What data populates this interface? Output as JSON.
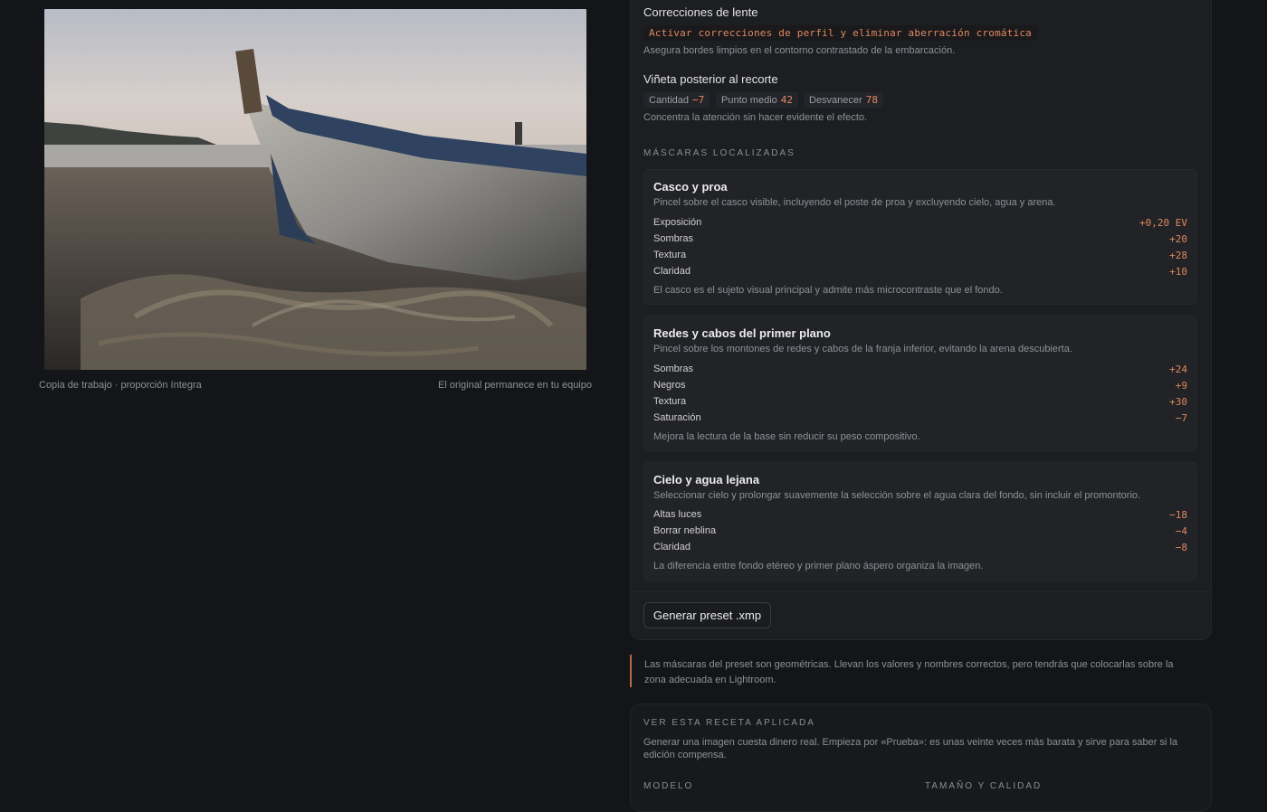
{
  "left": {
    "caption_left": "Copia de trabajo · proporción íntegra",
    "caption_right": "El original permanece en tu equipo"
  },
  "lens": {
    "title": "Correcciones de lente",
    "code": "Activar correcciones de perfil y eliminar aberración cromática",
    "desc": "Asegura bordes limpios en el contorno contrastado de la embarcación."
  },
  "vignette": {
    "title": "Viñeta posterior al recorte",
    "chips": [
      {
        "label": "Cantidad",
        "value": "−7"
      },
      {
        "label": "Punto medio",
        "value": "42"
      },
      {
        "label": "Desvanecer",
        "value": "78"
      }
    ],
    "desc": "Concentra la atención sin hacer evidente el efecto."
  },
  "masks": {
    "eyebrow": "MÁSCARAS LOCALIZADAS",
    "items": [
      {
        "title": "Casco y proa",
        "desc": "Pincel sobre el casco visible, incluyendo el poste de proa y excluyendo cielo, agua y arena.",
        "rows": [
          {
            "label": "Exposición",
            "value": "+0,20 EV"
          },
          {
            "label": "Sombras",
            "value": "+20"
          },
          {
            "label": "Textura",
            "value": "+28"
          },
          {
            "label": "Claridad",
            "value": "+10"
          }
        ],
        "foot": "El casco es el sujeto visual principal y admite más microcontraste que el fondo."
      },
      {
        "title": "Redes y cabos del primer plano",
        "desc": "Pincel sobre los montones de redes y cabos de la franja inferior, evitando la arena descubierta.",
        "rows": [
          {
            "label": "Sombras",
            "value": "+24"
          },
          {
            "label": "Negros",
            "value": "+9"
          },
          {
            "label": "Textura",
            "value": "+30"
          },
          {
            "label": "Saturación",
            "value": "−7"
          }
        ],
        "foot": "Mejora la lectura de la base sin reducir su peso compositivo."
      },
      {
        "title": "Cielo y agua lejana",
        "desc": "Seleccionar cielo y prolongar suavemente la selección sobre el agua clara del fondo, sin incluir el promontorio.",
        "rows": [
          {
            "label": "Altas luces",
            "value": "−18"
          },
          {
            "label": "Borrar neblina",
            "value": "−4"
          },
          {
            "label": "Claridad",
            "value": "−8"
          }
        ],
        "foot": "La diferencia entre fondo etéreo y primer plano áspero organiza la imagen."
      }
    ]
  },
  "actions": {
    "generate_label": "Generar preset .xmp"
  },
  "note": "Las máscaras del preset son geométricas. Llevan los valores y nombres correctos, pero tendrás que colocarlas sobre la zona adecuada en Lightroom.",
  "recipe": {
    "eyebrow": "VER ESTA RECETA APLICADA",
    "desc": "Generar una imagen cuesta dinero real. Empieza por «Prueba»: es unas veinte veces más barata y sirve para saber si la edición compensa.",
    "model_label": "MODELO",
    "size_label": "TAMAÑO Y CALIDAD"
  },
  "colors": {
    "accent": "#e0885f",
    "panel": "#1d1e22",
    "background": "#141518"
  }
}
